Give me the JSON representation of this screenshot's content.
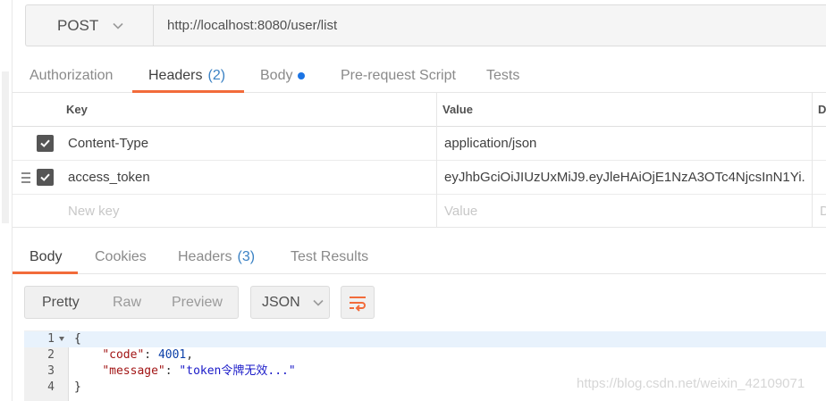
{
  "request": {
    "method": "POST",
    "url": "http://localhost:8080/user/list"
  },
  "request_tabs": {
    "authorization": "Authorization",
    "headers": "Headers",
    "headers_count": "(2)",
    "body": "Body",
    "prerequest": "Pre-request Script",
    "tests": "Tests"
  },
  "headers_table": {
    "columns": {
      "key": "Key",
      "value": "Value",
      "desc": "D"
    },
    "rows": [
      {
        "key": "Content-Type",
        "value": "application/json",
        "checked": true
      },
      {
        "key": "access_token",
        "value": "eyJhbGciOiJIUzUxMiJ9.eyJleHAiOjE1NzA3OTc4NjcsInN1Yi...",
        "checked": true
      }
    ],
    "placeholder": {
      "key": "New key",
      "value": "Value",
      "desc": "D"
    }
  },
  "response_tabs": {
    "body": "Body",
    "cookies": "Cookies",
    "headers": "Headers",
    "headers_count": "(3)",
    "test_results": "Test Results"
  },
  "response_toolbar": {
    "pretty": "Pretty",
    "raw": "Raw",
    "preview": "Preview",
    "format": "JSON"
  },
  "response_body": {
    "line_numbers": [
      "1",
      "2",
      "3",
      "4"
    ],
    "open_brace": "{",
    "close_brace": "}",
    "code_key": "\"code\"",
    "code_value": "4001",
    "message_key": "\"message\"",
    "message_value": "\"token令牌无效...\""
  },
  "watermark": "https://blog.csdn.net/weixin_42109071",
  "colors": {
    "accent_orange": "#f26b3a",
    "count_blue": "#3b82c4",
    "dot_blue": "#1b74e4",
    "checkbox": "#555555"
  }
}
